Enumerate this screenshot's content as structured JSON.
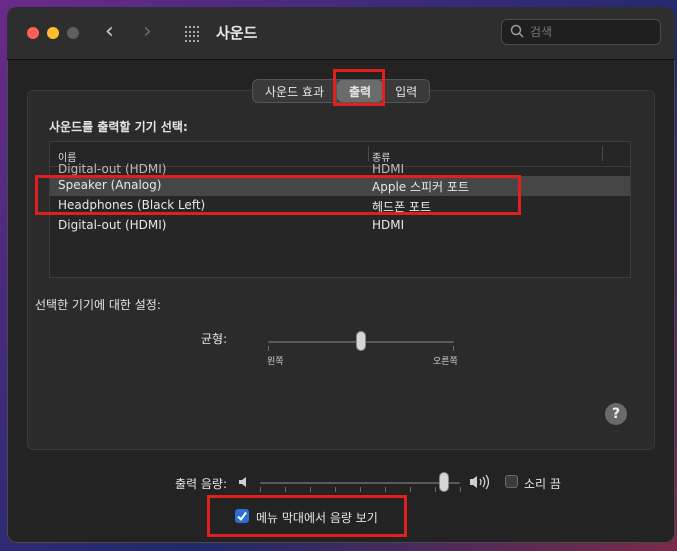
{
  "window": {
    "title": "사운드"
  },
  "search": {
    "placeholder": "검색"
  },
  "tabs": [
    {
      "label": "사운드 효과",
      "selected": false
    },
    {
      "label": "출력",
      "selected": true
    },
    {
      "label": "입력",
      "selected": false
    }
  ],
  "output": {
    "heading": "사운드를 출력할 기기 선택:",
    "columns": [
      "이름",
      "종류"
    ],
    "partial_row": {
      "name": "Digital-out (HDMI)",
      "type": "HDMI"
    },
    "rows": [
      {
        "name": "Speaker (Analog)",
        "type": "Apple 스피커 포트",
        "selected": true
      },
      {
        "name": "Headphones (Black Left)",
        "type": "헤드폰 포트",
        "selected": false
      },
      {
        "name": "Digital-out (HDMI)",
        "type": "HDMI",
        "selected": false
      }
    ],
    "settings_heading": "선택한 기기에 대한 설정:",
    "balance": {
      "label": "균형:",
      "left_label": "왼쪽",
      "right_label": "오른쪽",
      "value": 0.5
    }
  },
  "help_label": "?",
  "volume": {
    "label": "출력 음량:",
    "value": 0.92,
    "mute_label": "소리 끔",
    "muted": false
  },
  "menu_bar": {
    "label": "메뉴 막대에서 음량 보기",
    "checked": true
  },
  "colors": {
    "accent": "#2c6fd6",
    "highlight_box": "#e02020",
    "close": "#ff5f57",
    "minimize": "#febc2e"
  },
  "icons": [
    "back-chevron-icon",
    "forward-chevron-icon",
    "grid-icon",
    "search-icon",
    "speaker-low-icon",
    "speaker-high-icon",
    "help-icon",
    "checkmark-icon"
  ]
}
